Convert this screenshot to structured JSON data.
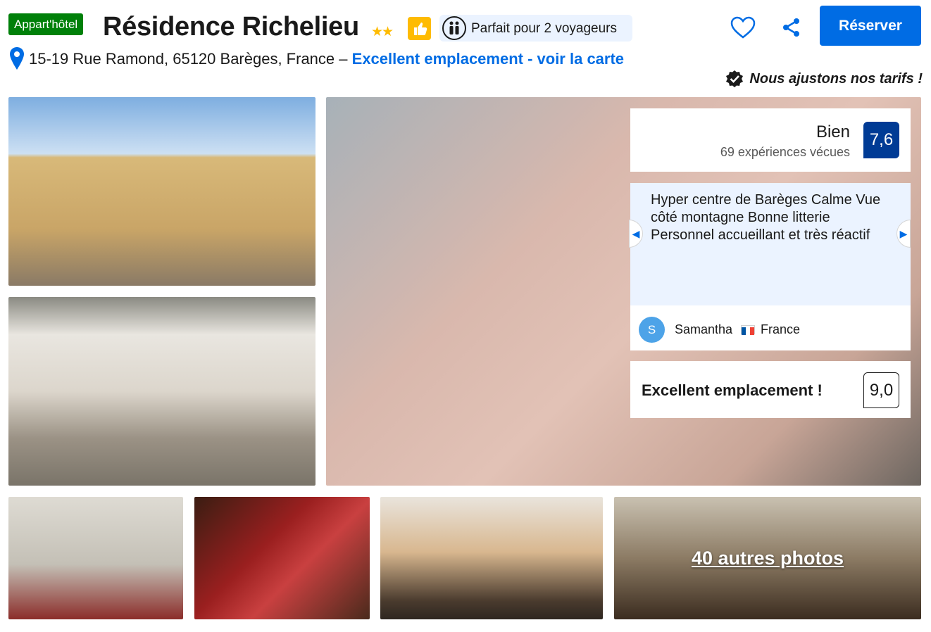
{
  "header": {
    "property_type_badge": "Appart'hôtel",
    "title": "Résidence Richelieu",
    "stars": "★★",
    "stars_count": 2,
    "travellers_label": "Parfait pour 2 voyageurs",
    "reserve_label": "Réserver"
  },
  "address": {
    "text": "15-19 Rue Ramond, 65120 Barèges, France –",
    "link_text": "Excellent emplacement - voir la carte"
  },
  "price_notice": "Nous ajustons nos tarifs !",
  "gallery": {
    "more_photos_label": "40 autres photos"
  },
  "rating": {
    "word": "Bien",
    "count_label": "69 expériences vécues",
    "score": "7,6"
  },
  "review": {
    "text": "Hyper centre de Barèges Calme Vue côté montagne Bonne litterie Personnel accueillant et très réactif",
    "avatar_initial": "S",
    "reviewer_name": "Samantha",
    "reviewer_country": "France"
  },
  "location": {
    "label": "Excellent emplacement !",
    "score": "9,0"
  },
  "colors": {
    "brand_blue": "#006ce4",
    "score_dark_blue": "#003b95",
    "badge_green": "#008009",
    "star_yellow": "#febb02",
    "review_bg": "#ebf3ff"
  },
  "icons": [
    "map-pin-icon",
    "heart-icon",
    "share-icon",
    "thumbs-up-icon",
    "travellers-icon",
    "verified-check-icon",
    "flag-france-icon",
    "chevron-left-icon",
    "chevron-right-icon"
  ]
}
